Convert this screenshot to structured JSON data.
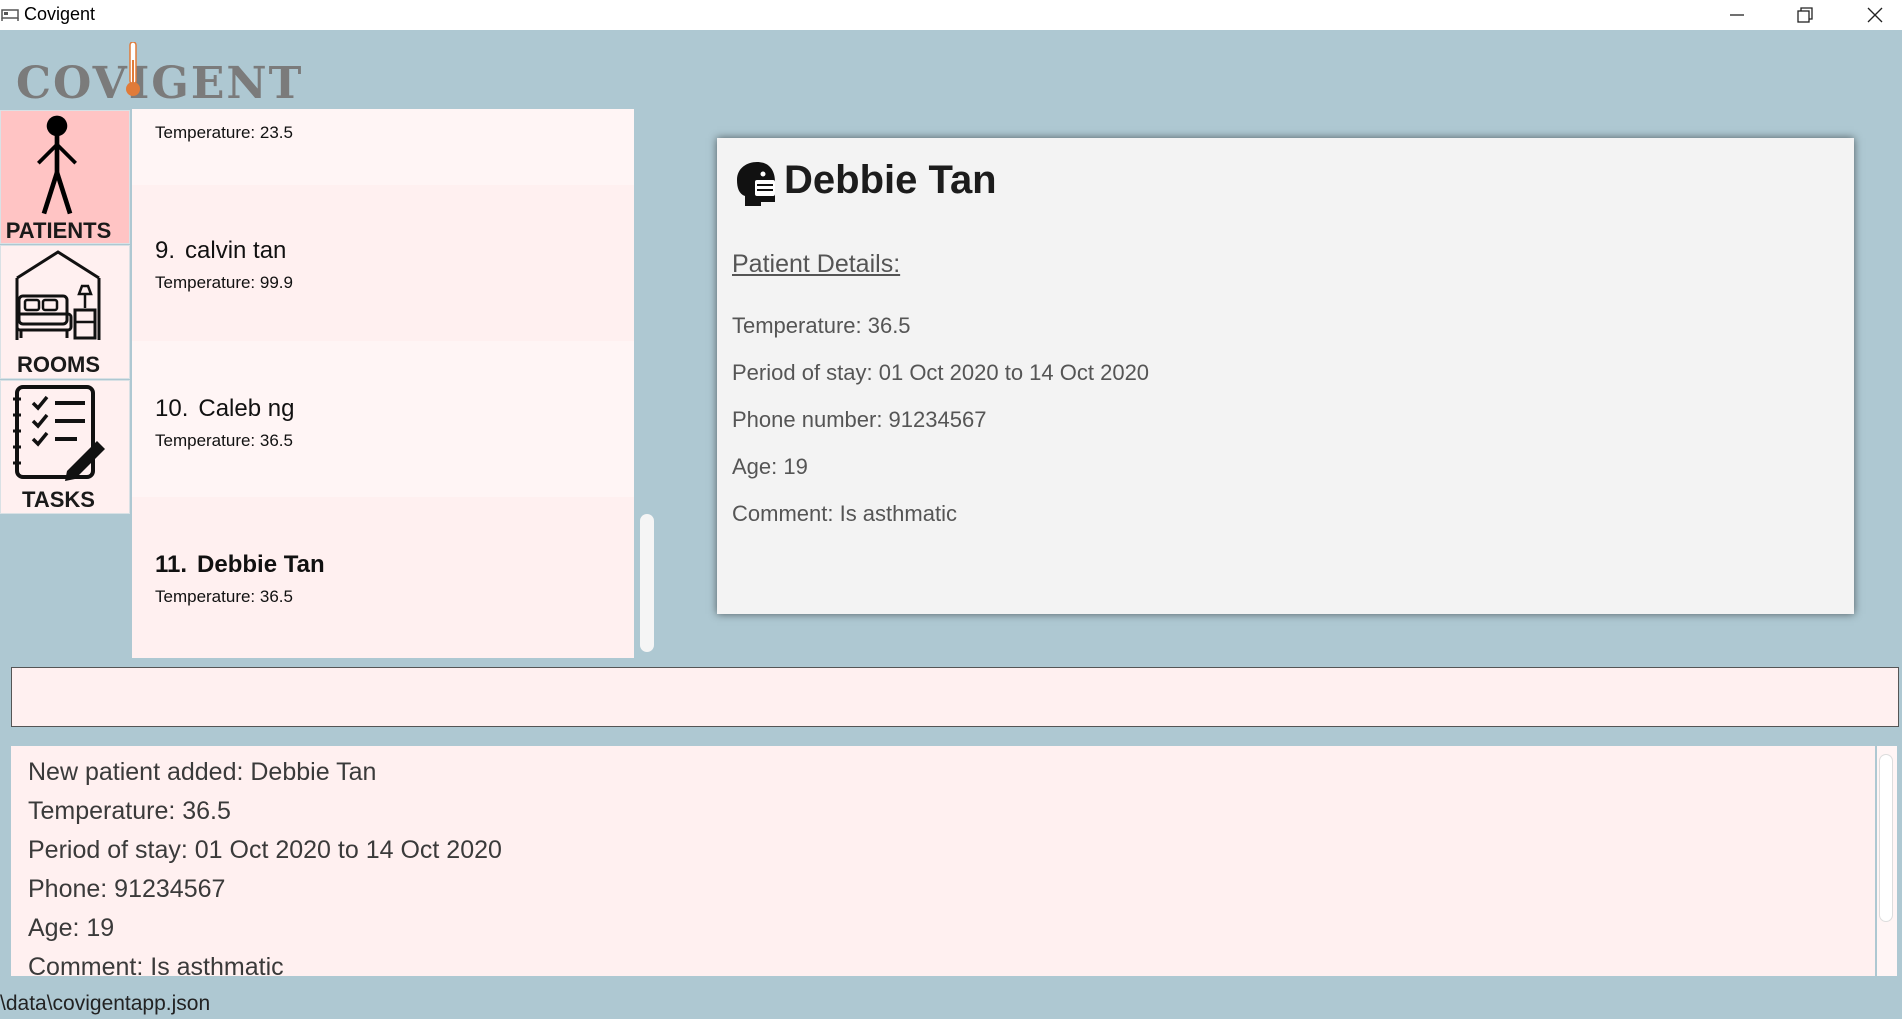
{
  "window": {
    "title": "Covigent",
    "icon": "hotel-bed-icon",
    "controls": [
      "minimize-icon",
      "restore-icon",
      "close-icon"
    ]
  },
  "logo": {
    "text": "COVIGENT",
    "accent_color": "#e07b39"
  },
  "nav": {
    "items": [
      {
        "label": "PATIENTS",
        "icon": "person-stick-figure-icon",
        "selected": true
      },
      {
        "label": "ROOMS",
        "icon": "bedroom-icon",
        "selected": false
      },
      {
        "label": "TASKS",
        "icon": "checklist-icon",
        "selected": false
      }
    ],
    "selected_color": "#ffc4c4"
  },
  "patient_list": {
    "partial_top": {
      "temperature": "Temperature: 23.5"
    },
    "items": [
      {
        "index": "9.",
        "name": "calvin tan",
        "temperature": "Temperature: 99.9"
      },
      {
        "index": "10.",
        "name": "Caleb ng",
        "temperature": "Temperature: 36.5"
      },
      {
        "index": "11.",
        "name": "Debbie Tan",
        "temperature": "Temperature: 36.5"
      }
    ]
  },
  "detail": {
    "icon": "masked-face-icon",
    "name": "Debbie Tan",
    "section_title": "Patient Details:",
    "fields": [
      "Temperature: 36.5",
      "Period of stay: 01 Oct 2020 to 14 Oct 2020",
      "Phone number: 91234567",
      "Age: 19",
      "Comment: Is asthmatic"
    ]
  },
  "command": {
    "value": "",
    "placeholder": ""
  },
  "result": {
    "lines": [
      "New patient added: Debbie Tan",
      "Temperature: 36.5",
      "Period of stay: 01 Oct 2020 to 14 Oct 2020",
      "Phone: 91234567",
      "Age: 19",
      "Comment: Is asthmatic"
    ]
  },
  "status": {
    "path": "\\data\\covigentapp.json"
  },
  "colors": {
    "background": "#aec8d2",
    "panel": "#fff0f0",
    "detail_panel": "#f3f3f3"
  }
}
